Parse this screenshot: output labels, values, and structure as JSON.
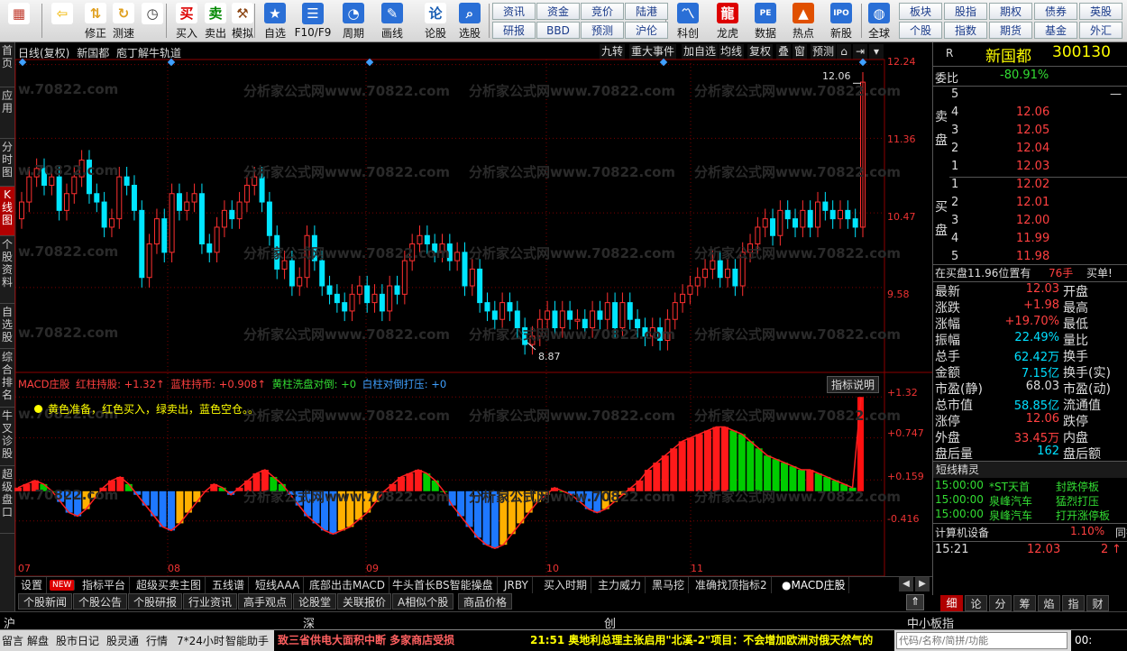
{
  "toolbar": {
    "left_buttons": [
      {
        "name": "home",
        "label": "",
        "icon": "logo-grid-icon"
      },
      {
        "name": "back",
        "label": "",
        "icon": "arrow-left-icon"
      },
      {
        "name": "modify",
        "label": "修正",
        "icon": "arrow-updown-icon"
      },
      {
        "name": "speed-test",
        "label": "测速",
        "icon": "refresh-icon"
      },
      {
        "name": "clock",
        "label": "",
        "icon": "clock-icon"
      },
      {
        "name": "buy",
        "label": "买入",
        "icon": "buy-icon"
      },
      {
        "name": "sell",
        "label": "卖出",
        "icon": "sell-icon"
      },
      {
        "name": "simulate",
        "label": "模拟",
        "icon": "hammer-icon"
      },
      {
        "name": "self-select",
        "label": "自选",
        "icon": "star-icon"
      },
      {
        "name": "f10",
        "label": "F10/F9",
        "icon": "list-icon"
      },
      {
        "name": "period",
        "label": "周期",
        "icon": "period-icon"
      },
      {
        "name": "draw",
        "label": "画线",
        "icon": "pencil-icon"
      },
      {
        "name": "stock-forum",
        "label": "论股",
        "icon": "forum-icon"
      },
      {
        "name": "stock-pick",
        "label": "选股",
        "icon": "magnifier-icon"
      }
    ],
    "menu_buttons_row1": [
      "资讯",
      "资金",
      "竞价",
      "陆港"
    ],
    "menu_buttons_row2": [
      "研报",
      "BBD",
      "预测",
      "沪伦"
    ],
    "right_buttons": [
      {
        "name": "science",
        "label": "科创",
        "icon": "chart-icon"
      },
      {
        "name": "dragon",
        "label": "龙虎",
        "icon": "dragon-icon"
      },
      {
        "name": "data",
        "label": "数据",
        "icon": "pe-icon"
      },
      {
        "name": "hot",
        "label": "热点",
        "icon": "fire-icon"
      },
      {
        "name": "ipo",
        "label": "新股",
        "icon": "ipo-icon"
      },
      {
        "name": "global",
        "label": "全球",
        "icon": "globe-icon"
      }
    ],
    "right_menu_row1": [
      "板块",
      "股指",
      "期权",
      "债券",
      "英股"
    ],
    "right_menu_row2": [
      "个股",
      "指数",
      "期货",
      "基金",
      "外汇"
    ]
  },
  "left_tabs": [
    "首页",
    "应用",
    "分时图",
    "K线图",
    "个股资料",
    "自选股",
    "综合排名",
    "牛叉诊股",
    "超级盘口"
  ],
  "chart_header": {
    "period": "日线(复权)",
    "stock": "新国都",
    "indicator": "庖丁解牛轨道",
    "buttons": [
      "九转",
      "重大事件",
      "加自选",
      "均线",
      "复权",
      "叠",
      "窗",
      "预测"
    ]
  },
  "price_axis": [
    "12.24",
    "11.36",
    "10.47",
    "9.58"
  ],
  "kline_annotations": {
    "high": "12.06",
    "low": "8.87"
  },
  "macd_header": {
    "name": "MACD庄股",
    "red": "红柱持股: +1.32↑",
    "blue": "蓝柱持币: +0.908↑",
    "yellow": "黄柱洗盘对倒: +0",
    "white": "白柱对倒打压: +0",
    "explain": "指标说明",
    "legend": "黄色准备，红色买入，绿卖出，蓝色空仓。。"
  },
  "macd_axis": [
    "+1.32",
    "+0.747",
    "+0.159",
    "-0.416"
  ],
  "dates": [
    "07",
    "08",
    "09",
    "10",
    "11"
  ],
  "watermark": [
    "w.70822.com",
    "分析家公式网",
    "分析家公式网www.70822.com"
  ],
  "indicator_tabs": [
    "设置",
    "NEW",
    "指标平台",
    "超级买卖主图",
    "五线谱",
    "短线AAA",
    "底部出击MACD",
    "牛头首长BS智能操盘",
    "JRBY",
    "买入时期",
    "主力威力",
    "黑马挖",
    "准确找顶指标2",
    "●MACD庄股"
  ],
  "news_tabs": [
    "个股新闻",
    "个股公告",
    "个股研报",
    "行业资讯",
    "高手观点",
    "论股堂",
    "关联报价",
    "A相似个股",
    "商品价格"
  ],
  "quote": {
    "header_r": "R",
    "name": "新国都",
    "code": "300130",
    "wei_label": "委比",
    "wei_value": "-80.91%",
    "sell_label": "卖盘",
    "buy_label": "买盘",
    "asks": [
      {
        "lvl": "5",
        "price": "",
        "vol": "—"
      },
      {
        "lvl": "4",
        "price": "12.06",
        "vol": ""
      },
      {
        "lvl": "3",
        "price": "12.05",
        "vol": ""
      },
      {
        "lvl": "2",
        "price": "12.04",
        "vol": ""
      },
      {
        "lvl": "1",
        "price": "12.03",
        "vol": ""
      }
    ],
    "bids": [
      {
        "lvl": "1",
        "price": "12.02",
        "vol": ""
      },
      {
        "lvl": "2",
        "price": "12.01",
        "vol": ""
      },
      {
        "lvl": "3",
        "price": "12.00",
        "vol": ""
      },
      {
        "lvl": "4",
        "price": "11.99",
        "vol": ""
      },
      {
        "lvl": "5",
        "price": "11.98",
        "vol": ""
      }
    ],
    "notice": "在买盘11.96位置有",
    "notice_vol": "76手",
    "notice_action": "买单!",
    "stats": [
      {
        "l": "最新",
        "v": "12.03",
        "c": "up",
        "l2": "开盘",
        "v2": ""
      },
      {
        "l": "涨跌",
        "v": "+1.98",
        "c": "up",
        "l2": "最高",
        "v2": ""
      },
      {
        "l": "涨幅",
        "v": "+19.70%",
        "c": "up",
        "l2": "最低",
        "v2": ""
      },
      {
        "l": "振幅",
        "v": "22.49%",
        "c": "cy",
        "l2": "量比",
        "v2": ""
      },
      {
        "l": "总手",
        "v": "62.42万",
        "c": "cy",
        "l2": "换手",
        "v2": ""
      },
      {
        "l": "金额",
        "v": "7.15亿",
        "c": "cy",
        "l2": "换手(实)",
        "v2": ""
      },
      {
        "l": "市盈(静)",
        "v": "68.03",
        "c": "wh",
        "l2": "市盈(动)",
        "v2": ""
      },
      {
        "l": "总市值",
        "v": "58.85亿",
        "c": "cy",
        "l2": "流通值",
        "v2": ""
      },
      {
        "l": "涨停",
        "v": "12.06",
        "c": "up",
        "l2": "跌停",
        "v2": ""
      },
      {
        "l": "外盘",
        "v": "33.45万",
        "c": "up",
        "l2": "内盘",
        "v2": ""
      },
      {
        "l": "盘后量",
        "v": "162",
        "c": "cy",
        "l2": "盘后额",
        "v2": ""
      }
    ],
    "wizard_title": "短线精灵",
    "wizard": [
      {
        "t": "15:00:00",
        "s": "*ST天首",
        "e": "封跌停板"
      },
      {
        "t": "15:00:00",
        "s": "泉峰汽车",
        "e": "猛烈打压"
      },
      {
        "t": "15:00:00",
        "s": "泉峰汽车",
        "e": "打开涨停板"
      }
    ],
    "sector": "计算机设备",
    "sector_pct": "1.10%",
    "sector_tail": "同行",
    "tick_time": "15:21",
    "tick_price": "12.03",
    "tick_vol": "2",
    "bottom_tabs": [
      "细",
      "论",
      "分",
      "筹",
      "焰",
      "指",
      "财"
    ]
  },
  "ticker": {
    "left": "沪",
    "mid1": "深",
    "mid2": "创",
    "right": "中小板指"
  },
  "status": {
    "items": [
      "留言",
      "解盘",
      "股市日记",
      "股灵通",
      "行情",
      "7*24小时",
      "智能助手"
    ],
    "news1": "致三省供电大面积中断 多家商店受损",
    "news2_time": "21:51",
    "news2": "奥地利总理主张启用\"北溪-2\"项目：不会增加欧洲对俄天然气的",
    "search_placeholder": "代码/名称/简拼/功能",
    "clock": "00:"
  },
  "chart_data": [
    {
      "type": "candlestick",
      "title": "日线(复权) 新国都 庖丁解牛轨道",
      "xlabel": "",
      "ylabel": "",
      "ylim": [
        8.6,
        12.3
      ],
      "y_ticks": [
        12.24,
        11.36,
        10.47,
        9.58
      ],
      "x_ticks": [
        "07",
        "08",
        "09",
        "10",
        "11"
      ],
      "annotations": [
        {
          "label": "12.06",
          "value": 12.06
        },
        {
          "label": "8.87",
          "value": 8.87
        }
      ],
      "close": [
        10.6,
        10.9,
        11.0,
        10.8,
        10.9,
        10.5,
        10.7,
        10.9,
        11.1,
        10.7,
        10.6,
        10.3,
        10.4,
        10.9,
        10.8,
        10.5,
        9.7,
        10.1,
        10.4,
        10.0,
        10.7,
        10.5,
        10.6,
        10.7,
        10.1,
        10.0,
        10.3,
        10.5,
        10.4,
        10.6,
        10.8,
        10.9,
        10.6,
        10.2,
        9.8,
        9.9,
        9.6,
        9.7,
        10.2,
        9.9,
        9.6,
        9.5,
        9.4,
        9.3,
        9.5,
        9.6,
        9.4,
        9.5,
        9.3,
        9.6,
        9.5,
        9.9,
        10.1,
        10.2,
        10.1,
        10.0,
        10.1,
        9.9,
        10.0,
        9.6,
        9.8,
        9.4,
        9.3,
        9.2,
        9.4,
        9.3,
        9.1,
        8.9,
        9.0,
        9.2,
        9.3,
        9.1,
        9.3,
        9.2,
        9.2,
        9.1,
        9.3,
        9.2,
        9.4,
        9.1,
        9.4,
        9.2,
        9.1,
        9.0,
        9.1,
        8.95,
        9.2,
        9.4,
        9.5,
        9.6,
        9.7,
        9.8,
        9.9,
        9.7,
        9.8,
        9.6,
        10.0,
        10.1,
        10.3,
        10.4,
        10.2,
        10.5,
        10.4,
        10.3,
        10.5,
        10.3,
        10.6,
        10.5,
        10.4,
        10.5,
        10.4,
        10.3,
        12.03
      ],
      "open": [
        10.4,
        10.6,
        10.9,
        11.0,
        10.8,
        10.9,
        10.5,
        10.7,
        10.9,
        11.1,
        10.7,
        10.6,
        10.3,
        10.4,
        10.9,
        10.8,
        10.5,
        9.7,
        10.1,
        10.4,
        10.0,
        10.7,
        10.5,
        10.6,
        10.7,
        10.1,
        10.0,
        10.3,
        10.5,
        10.4,
        10.6,
        10.8,
        10.9,
        10.6,
        10.2,
        9.8,
        9.9,
        9.6,
        9.7,
        10.2,
        9.9,
        9.6,
        9.5,
        9.4,
        9.3,
        9.5,
        9.6,
        9.4,
        9.5,
        9.3,
        9.6,
        9.5,
        9.9,
        10.1,
        10.2,
        10.1,
        10.0,
        10.1,
        9.9,
        10.0,
        9.6,
        9.8,
        9.4,
        9.3,
        9.2,
        9.4,
        9.3,
        9.1,
        8.9,
        9.0,
        9.2,
        9.3,
        9.1,
        9.3,
        9.2,
        9.2,
        9.1,
        9.3,
        9.2,
        9.4,
        9.1,
        9.4,
        9.2,
        9.1,
        9.0,
        9.1,
        8.95,
        9.2,
        9.4,
        9.5,
        9.6,
        9.7,
        9.8,
        9.9,
        9.7,
        9.8,
        9.6,
        10.0,
        10.1,
        10.3,
        10.4,
        10.2,
        10.5,
        10.4,
        10.3,
        10.5,
        10.3,
        10.6,
        10.5,
        10.4,
        10.5,
        10.4,
        10.3
      ]
    },
    {
      "type": "bar",
      "title": "MACD庄股",
      "xlabel": "",
      "ylabel": "",
      "ylim": [
        -0.95,
        1.45
      ],
      "y_ticks": [
        1.32,
        0.747,
        0.159,
        -0.416
      ],
      "series": [
        {
          "name": "MACD庄股",
          "values": [
            0.05,
            0.1,
            0.15,
            0.1,
            0.0,
            -0.15,
            -0.3,
            -0.35,
            -0.25,
            -0.1,
            0.05,
            0.15,
            0.2,
            0.1,
            -0.05,
            -0.2,
            -0.35,
            -0.5,
            -0.55,
            -0.45,
            -0.3,
            -0.15,
            0.0,
            0.1,
            0.05,
            -0.05,
            0.05,
            0.15,
            0.25,
            0.3,
            0.2,
            0.1,
            -0.05,
            -0.2,
            -0.35,
            -0.45,
            -0.55,
            -0.6,
            -0.55,
            -0.5,
            -0.4,
            -0.3,
            -0.15,
            0.0,
            0.1,
            0.2,
            0.25,
            0.3,
            0.25,
            0.15,
            0.0,
            -0.2,
            -0.35,
            -0.5,
            -0.65,
            -0.75,
            -0.8,
            -0.75,
            -0.6,
            -0.45,
            -0.3,
            -0.15,
            -0.05,
            0.05,
            0.0,
            -0.05,
            -0.15,
            -0.25,
            -0.3,
            -0.25,
            -0.15,
            -0.05,
            0.05,
            0.15,
            0.3,
            0.4,
            0.5,
            0.6,
            0.7,
            0.75,
            0.8,
            0.85,
            0.9,
            0.9,
            0.85,
            0.8,
            0.7,
            0.6,
            0.5,
            0.45,
            0.4,
            0.35,
            0.3,
            0.3,
            0.25,
            0.2,
            0.15,
            0.1,
            0.05,
            1.32
          ]
        }
      ]
    }
  ]
}
